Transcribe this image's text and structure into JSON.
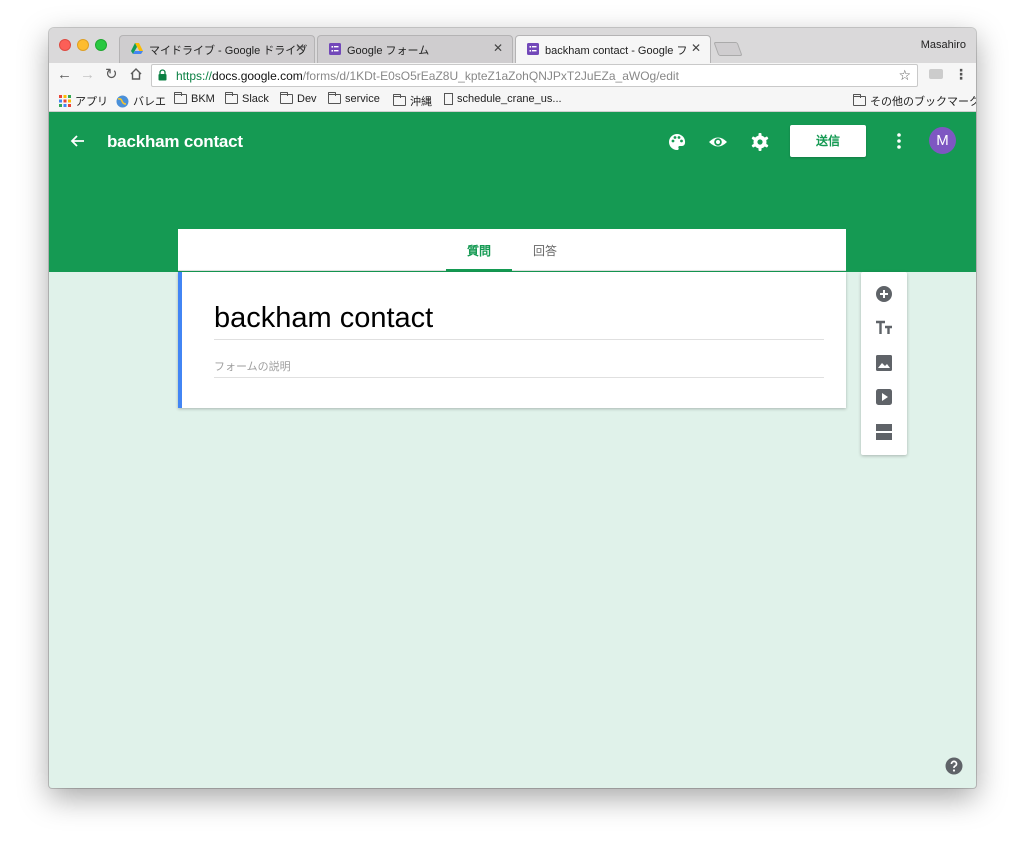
{
  "browser": {
    "profile_name": "Masahiro",
    "tabs": [
      {
        "title": "マイドライブ - Google ドライブ",
        "icon": "google-drive-icon",
        "active": false
      },
      {
        "title": "Google フォーム",
        "icon": "google-forms-icon",
        "active": false
      },
      {
        "title": "backham contact - Google フォ",
        "icon": "google-forms-icon",
        "active": true
      }
    ],
    "url": {
      "scheme": "https://",
      "host": "docs.google.com",
      "path": "/forms/d/1KDt-E0sO5rEaZ8U_kpteZ1aZohQNJPxT2JuEZa_aWOg/edit"
    },
    "bookmarks": [
      {
        "label": "アプリ",
        "icon": "apps-grid-icon"
      },
      {
        "label": "バレエ",
        "icon": "globe-icon"
      },
      {
        "label": "BKM",
        "icon": "folder-icon"
      },
      {
        "label": "Slack",
        "icon": "folder-icon"
      },
      {
        "label": "Dev",
        "icon": "folder-icon"
      },
      {
        "label": "service",
        "icon": "folder-icon"
      },
      {
        "label": "沖縄",
        "icon": "folder-icon"
      },
      {
        "label": "schedule_crane_us...",
        "icon": "file-icon"
      }
    ],
    "other_bookmarks": "その他のブックマーク"
  },
  "forms": {
    "header_title": "backham contact",
    "send_label": "送信",
    "avatar_initial": "M",
    "tabs": [
      {
        "label": "質問",
        "active": true
      },
      {
        "label": "回答",
        "active": false
      }
    ],
    "card": {
      "title": "backham contact",
      "description_placeholder": "フォームの説明"
    },
    "colors": {
      "header_green": "#159a53",
      "background": "#e0f2ea",
      "accent_blue": "#4285f4",
      "avatar_purple": "#7e57c2"
    }
  }
}
